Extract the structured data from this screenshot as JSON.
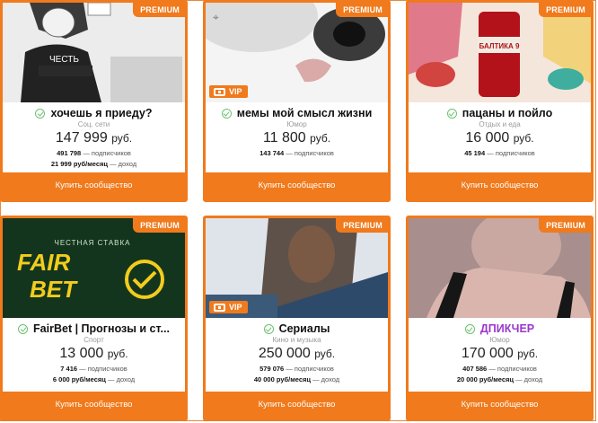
{
  "colors": {
    "accent": "#f07a1c",
    "verified": "#6cc16f",
    "title_purple": "#9b37cf"
  },
  "cards": [
    {
      "badge": "PREMIUM",
      "vip": "",
      "title": "хочешь я приеду?",
      "category": "Соц. сети",
      "price": "147 999",
      "currency": "руб.",
      "subscribers": "491 798",
      "subscribers_label": "— подписчиков",
      "income": "21 999 руб/месяц",
      "income_label": "— доход",
      "button": "Купить сообщество",
      "image_text": "ЧЕСТЬ"
    },
    {
      "badge": "PREMIUM",
      "vip": "VIP",
      "title": "мемы мой смысл жизни",
      "category": "Юмор",
      "price": "11 800",
      "currency": "руб.",
      "subscribers": "143 744",
      "subscribers_label": "— подписчиков",
      "income": "",
      "income_label": "",
      "button": "Купить сообщество",
      "image_text": ""
    },
    {
      "badge": "PREMIUM",
      "vip": "",
      "title": "пацаны и пойло",
      "category": "Отдых и еда",
      "price": "16 000",
      "currency": "руб.",
      "subscribers": "45 194",
      "subscribers_label": "— подписчиков",
      "income": "",
      "income_label": "",
      "button": "Купить сообщество",
      "image_text": "БАЛТИКА 9"
    },
    {
      "badge": "PREMIUM",
      "vip": "",
      "title": "FairBet | Прогнозы и ст...",
      "category": "Спорт",
      "price": "13 000",
      "currency": "руб.",
      "subscribers": "7 416",
      "subscribers_label": "— подписчиков",
      "income": "6 000 руб/месяц",
      "income_label": "— доход",
      "button": "Купить сообщество",
      "image_text": "ЧЕСТНАЯ СТАВКА",
      "logo_line1": "FAIR",
      "logo_line2": "BET"
    },
    {
      "badge": "PREMIUM",
      "vip": "VIP",
      "title": "Сериалы",
      "category": "Кино и музыка",
      "price": "250 000",
      "currency": "руб.",
      "subscribers": "579 076",
      "subscribers_label": "— подписчиков",
      "income": "40 000 руб/месяц",
      "income_label": "— доход",
      "button": "Купить сообщество",
      "image_text": ""
    },
    {
      "badge": "PREMIUM",
      "vip": "",
      "title": "ДПИКЧЕР",
      "category": "Юмор",
      "price": "170 000",
      "currency": "руб.",
      "subscribers": "407 586",
      "subscribers_label": "— подписчиков",
      "income": "20 000 руб/месяц",
      "income_label": "— доход",
      "button": "Купить сообщество",
      "image_text": ""
    }
  ]
}
